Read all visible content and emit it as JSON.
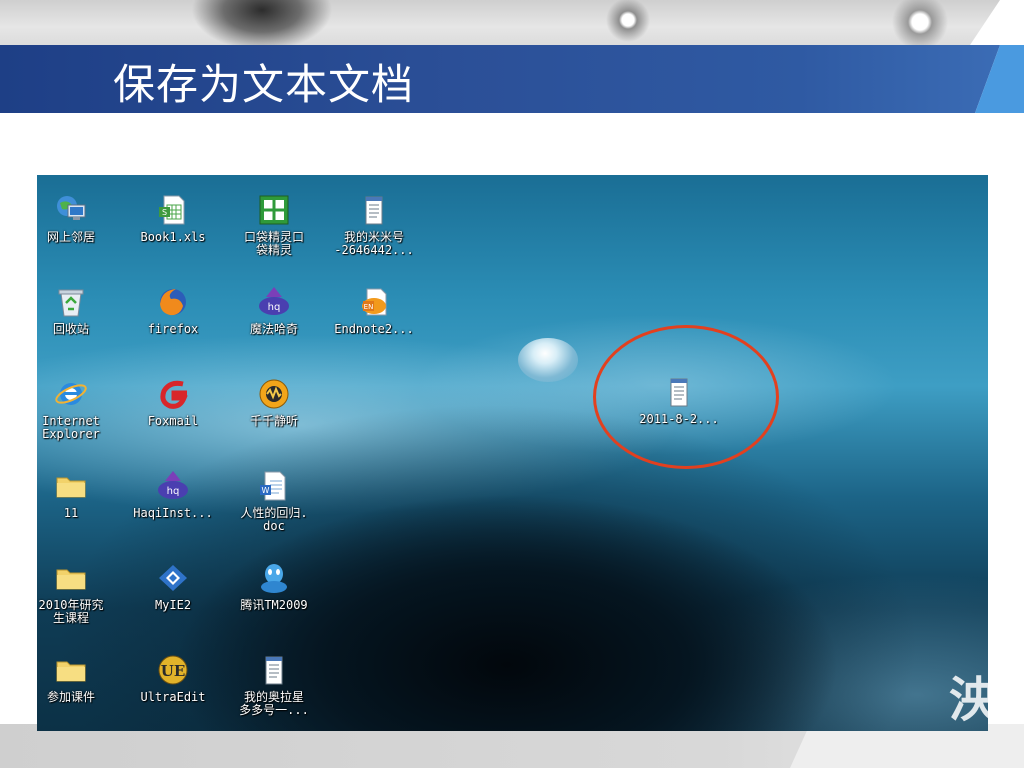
{
  "slide": {
    "title": "保存为文本文档"
  },
  "desktop": {
    "icons": [
      {
        "label": "网上邻居"
      },
      {
        "label": "Book1.xls"
      },
      {
        "label": "口袋精灵口\n袋精灵"
      },
      {
        "label": "我的米米号\n-2646442..."
      },
      {
        "label": "回收站"
      },
      {
        "label": "firefox"
      },
      {
        "label": "魔法哈奇"
      },
      {
        "label": "Endnote2..."
      },
      {
        "label": "Internet\nExplorer"
      },
      {
        "label": "Foxmail"
      },
      {
        "label": "千千静听"
      },
      {
        "label": "11"
      },
      {
        "label": "HaqiInst..."
      },
      {
        "label": "人性的回归.\ndoc"
      },
      {
        "label": "2010年研究\n生课程"
      },
      {
        "label": "MyIE2"
      },
      {
        "label": "腾讯TM2009"
      },
      {
        "label": "参加课件"
      },
      {
        "label": "UltraEdit"
      },
      {
        "label": "我的奥拉星\n多多号一..."
      },
      {
        "label": "2011-8-2..."
      }
    ],
    "watermark": "泱"
  },
  "colors": {
    "title_band": "#2b4f97",
    "highlight_ring": "#e2401f",
    "accent": "#4a9ae0"
  }
}
